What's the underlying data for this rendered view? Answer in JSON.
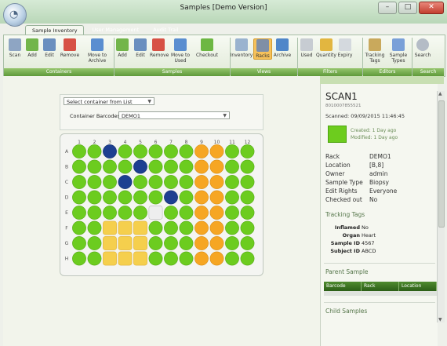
{
  "window": {
    "title": "Samples [Demo Version]",
    "minimize": "–",
    "maximize": "□",
    "close": "✕"
  },
  "tabs": [
    "Sample Inventory",
    "User Management",
    "Audit Trail"
  ],
  "ribbon": {
    "buttons": [
      {
        "label": "Scan",
        "icon": "scan-icon"
      },
      {
        "label": "Add",
        "icon": "add-icon"
      },
      {
        "label": "Edit",
        "icon": "edit-icon"
      },
      {
        "label": "Remove",
        "icon": "remove-icon"
      },
      {
        "label": "Move to Archive",
        "icon": "move-to-archive-icon"
      },
      {
        "label": "Add",
        "icon": "add-icon"
      },
      {
        "label": "Edit",
        "icon": "edit-icon"
      },
      {
        "label": "Remove",
        "icon": "remove-icon"
      },
      {
        "label": "Move to Used",
        "icon": "move-to-used-icon"
      },
      {
        "label": "Checkout",
        "icon": "checkout-icon"
      },
      {
        "label": "Inventory",
        "icon": "inventory-icon"
      },
      {
        "label": "Racks",
        "icon": "racks-icon"
      },
      {
        "label": "Archive",
        "icon": "archive-icon"
      },
      {
        "label": "Used",
        "icon": "used-icon"
      },
      {
        "label": "Quantity",
        "icon": "quantity-icon"
      },
      {
        "label": "Expiry",
        "icon": "expiry-icon"
      },
      {
        "label": "Tracking Tags",
        "icon": "tracking-tags-icon"
      },
      {
        "label": "Sample Types",
        "icon": "sample-types-icon"
      },
      {
        "label": "Search",
        "icon": "search-icon"
      }
    ],
    "groups": [
      "Containers",
      "Samples",
      "Views",
      "Filters",
      "Editors",
      "Search"
    ]
  },
  "selector": {
    "list_label": "Select container from List",
    "barcodes_label": "Container Barcodes",
    "barcode_value": "DEMO1",
    "dropdown_arrow": "▼"
  },
  "rack": {
    "columns": [
      "1",
      "2",
      "3",
      "4",
      "5",
      "6",
      "7",
      "8",
      "9",
      "10",
      "11",
      "12"
    ],
    "rows": [
      "A",
      "B",
      "C",
      "D",
      "E",
      "F",
      "G",
      "H"
    ],
    "colors": {
      "G": "#6ccc1f",
      "B": "#1d3f91",
      "O": "#f6a623",
      "Y": "#f5cf4d",
      "W": "#eeeeee"
    },
    "wells": [
      "GGBGGGGGOOGG",
      "GGGGBGGGOOGG",
      "GGGBGGGGOOGG",
      "GGGGGGBGOOGG",
      "GGGGGWGGOOGG",
      "GGYYYGGGOOGG",
      "GGYYYGGGOOGG",
      "GGYYYGGGOOGG"
    ]
  },
  "sample": {
    "title": "SCAN1",
    "barcode": "8010007855521",
    "scanned": "Scanned: 09/09/2015 11:46:45",
    "color": "#6dcc1e",
    "created": "Created: 1 Day ago",
    "modified": "Modified: 1 Day ago",
    "props": [
      {
        "k": "Rack",
        "v": "DEMO1"
      },
      {
        "k": "Location",
        "v": "[B,8]"
      },
      {
        "k": "Owner",
        "v": "admin"
      },
      {
        "k": "Sample Type",
        "v": "Biopsy"
      },
      {
        "k": "Edit Rights",
        "v": "Everyone"
      },
      {
        "k": "Checked out",
        "v": "No"
      }
    ],
    "tracking_header": "Tracking Tags",
    "tags": [
      {
        "k": "Inflamed",
        "v": "No"
      },
      {
        "k": "Organ",
        "v": "Heart"
      },
      {
        "k": "Sample ID",
        "v": "4567"
      },
      {
        "k": "Subject ID",
        "v": "ABCD"
      }
    ],
    "parent_header": "Parent Sample",
    "parent_columns": [
      "Barcode",
      "Rack",
      "Location"
    ],
    "child_header": "Child Samples"
  },
  "scrollbar": {
    "up": "▲",
    "down": "▼"
  }
}
